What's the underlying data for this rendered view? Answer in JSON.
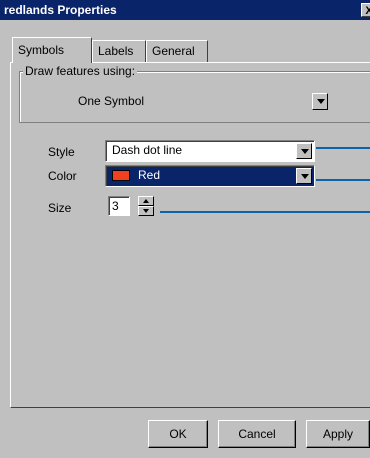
{
  "window": {
    "title": "redlands Properties",
    "close_glyph": "X"
  },
  "tabs": [
    {
      "label": "Symbols",
      "active": true
    },
    {
      "label": "Labels",
      "active": false
    },
    {
      "label": "General",
      "active": false
    }
  ],
  "draw_features": {
    "group_label": "Draw features using:",
    "selected": "One Symbol"
  },
  "style": {
    "label": "Style",
    "selected": "Dash dot line"
  },
  "color": {
    "label": "Color",
    "selected": "Red",
    "swatch_color": "#f04020"
  },
  "size": {
    "label": "Size",
    "value": "3"
  },
  "preview": {
    "line_color": "#0a64a8"
  },
  "buttons": {
    "ok": "OK",
    "cancel": "Cancel",
    "apply": "Apply"
  }
}
